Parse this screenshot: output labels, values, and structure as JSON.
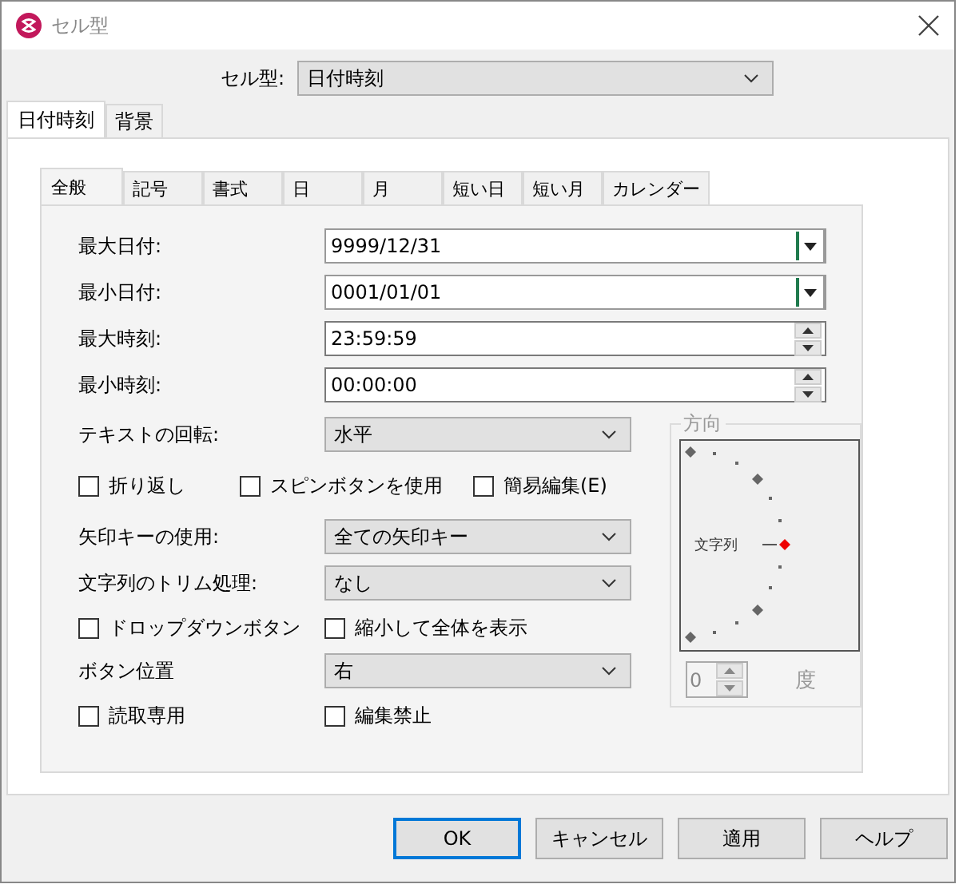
{
  "window": {
    "title": "セル型"
  },
  "cell_type": {
    "label": "セル型:",
    "value": "日付時刻"
  },
  "outer_tabs": [
    {
      "label": "日付時刻",
      "selected": true
    },
    {
      "label": "背景",
      "selected": false
    }
  ],
  "inner_tabs": [
    {
      "label": "全般",
      "selected": true
    },
    {
      "label": "記号",
      "selected": false
    },
    {
      "label": "書式",
      "selected": false
    },
    {
      "label": "日",
      "selected": false
    },
    {
      "label": "月",
      "selected": false
    },
    {
      "label": "短い日",
      "selected": false
    },
    {
      "label": "短い月",
      "selected": false
    },
    {
      "label": "カレンダー",
      "selected": false
    }
  ],
  "value_fields": [
    {
      "label": "最大日付:",
      "value": "9999/12/31",
      "kind": "date"
    },
    {
      "label": "最小日付:",
      "value": "0001/01/01",
      "kind": "date"
    },
    {
      "label": "最大時刻:",
      "value": "23:59:59",
      "kind": "time"
    },
    {
      "label": "最小時刻:",
      "value": "00:00:00",
      "kind": "time"
    }
  ],
  "options": [
    {
      "kind": "select",
      "label": "テキストの回転:",
      "value": "水平"
    },
    {
      "kind": "checks",
      "items": [
        {
          "label": "折り返し",
          "checked": false
        },
        {
          "label": "スピンボタンを使用",
          "checked": false
        },
        {
          "label": "簡易編集(E)",
          "checked": false
        }
      ]
    },
    {
      "kind": "select",
      "label": "矢印キーの使用:",
      "value": "全ての矢印キー"
    },
    {
      "kind": "select",
      "label": "文字列のトリム処理:",
      "value": "なし"
    },
    {
      "kind": "checks",
      "items": [
        {
          "label": "ドロップダウンボタン",
          "checked": false
        },
        {
          "label": "縮小して全体を表示",
          "checked": false
        }
      ]
    },
    {
      "kind": "select",
      "label": "ボタン位置",
      "value": "右"
    },
    {
      "kind": "checks",
      "items": [
        {
          "label": "読取専用",
          "checked": false
        },
        {
          "label": "編集禁止",
          "checked": false
        }
      ]
    }
  ],
  "direction": {
    "title": "方向",
    "label": "文字列",
    "angle": "0",
    "unit": "度",
    "disabled": true
  },
  "buttons": [
    {
      "label": "OK",
      "default": true
    },
    {
      "label": "キャンセル",
      "default": false
    },
    {
      "label": "適用",
      "default": false
    },
    {
      "label": "ヘルプ",
      "default": false
    }
  ]
}
